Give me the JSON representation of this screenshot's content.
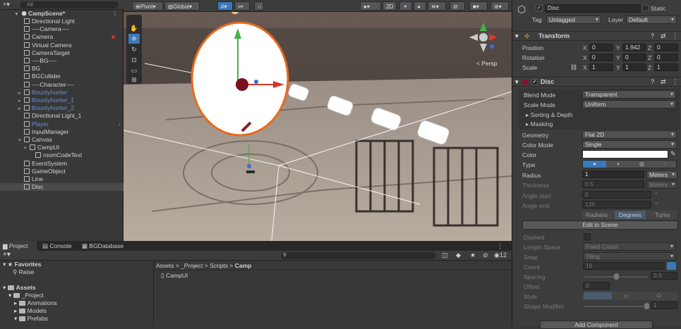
{
  "hierarchy": {
    "search_placeholder": "All",
    "scene_name": "CampScene*",
    "items": [
      {
        "label": "Directional Light",
        "indent": 1
      },
      {
        "label": "----Camera----",
        "indent": 1
      },
      {
        "label": "Camera",
        "indent": 1
      },
      {
        "label": "Virtual Camera",
        "indent": 1
      },
      {
        "label": "CameraTarget",
        "indent": 1
      },
      {
        "label": "----BG----",
        "indent": 1
      },
      {
        "label": "BG",
        "indent": 1
      },
      {
        "label": "BGCollider",
        "indent": 1
      },
      {
        "label": "----Character----",
        "indent": 1
      },
      {
        "label": "Bountyhunter",
        "indent": 1
      },
      {
        "label": "Bountyhunter_1",
        "indent": 1
      },
      {
        "label": "Bountyhunter_2",
        "indent": 1
      },
      {
        "label": "Directional Light_1",
        "indent": 1
      },
      {
        "label": "Player",
        "indent": 1
      },
      {
        "label": "InputManager",
        "indent": 1
      },
      {
        "label": "Canvas",
        "indent": 1
      },
      {
        "label": "CampUI",
        "indent": 2
      },
      {
        "label": "roomCodeText",
        "indent": 3
      },
      {
        "label": "EventSystem",
        "indent": 1
      },
      {
        "label": "GameObject",
        "indent": 1
      },
      {
        "label": "Line",
        "indent": 1
      },
      {
        "label": "Disc",
        "indent": 1
      }
    ]
  },
  "scene_toolbar": {
    "pivot": "Pivot",
    "global": "Global",
    "mode_2d": "2D",
    "persp": "< Persp"
  },
  "inspector": {
    "object_name": "Disc",
    "static_label": "Static",
    "tag_label": "Tag",
    "tag_value": "Untagged",
    "layer_label": "Layer",
    "layer_value": "Default",
    "transform": {
      "title": "Transform",
      "position_label": "Position",
      "rotation_label": "Rotation",
      "scale_label": "Scale",
      "position": {
        "x": "0",
        "y": "1.942",
        "z": "0"
      },
      "rotation": {
        "x": "0",
        "y": "0",
        "z": "0"
      },
      "scale": {
        "x": "1",
        "y": "1",
        "z": "1"
      }
    },
    "disc": {
      "title": "Disc",
      "blend_mode_label": "Blend Mode",
      "blend_mode": "Transparent",
      "scale_mode_label": "Scale Mode",
      "scale_mode": "Uniform",
      "sorting_depth": "Sorting & Depth",
      "masking": "Masking",
      "geometry_label": "Geometry",
      "geometry": "Flat 2D",
      "color_mode_label": "Color Mode",
      "color_mode": "Single",
      "color_label": "Color",
      "type_label": "Type",
      "radius_label": "Radius",
      "radius": "1",
      "radius_unit": "Meters",
      "thickness_label": "Thickness",
      "thickness": "0.5",
      "thickness_unit": "Meters",
      "angle_start_label": "Angle start",
      "angle_start": "0",
      "angle_end_label": "Angle end",
      "angle_end": "135",
      "radians": "Radians",
      "degrees": "Degrees",
      "turns": "Turns",
      "edit_in_scene": "Edit in Scene",
      "dashed_label": "Dashed",
      "length_space_label": "Length Space",
      "length_space": "Fixed Count",
      "snap_label": "Snap",
      "snap": "Tiling",
      "count_label": "Count",
      "count": "16",
      "spacing_label": "Spacing",
      "spacing": "0.5",
      "offset_label": "Offset",
      "offset": "0",
      "style_label": "Style",
      "shape_modifier_label": "Shape Modifier",
      "shape_modifier": "1"
    },
    "add_component": "Add Component"
  },
  "project": {
    "tabs": [
      "Project",
      "Console",
      "BGDatabase"
    ],
    "favorites_label": "Favorites",
    "favorites": [
      "Raise"
    ],
    "assets_label": "Assets",
    "tree": [
      "_Project",
      "Animations",
      "Models",
      "Prefabs"
    ],
    "breadcrumb": [
      "Assets",
      "_Project",
      "Scripts",
      "Camp"
    ],
    "files": [
      "CampUI"
    ],
    "count_badge": "12"
  },
  "colors": {
    "accent_blue": "#3a79bb",
    "disc_orange": "#e8691a",
    "gizmo_red": "#d23a2a",
    "gizmo_green": "#44b34a"
  }
}
